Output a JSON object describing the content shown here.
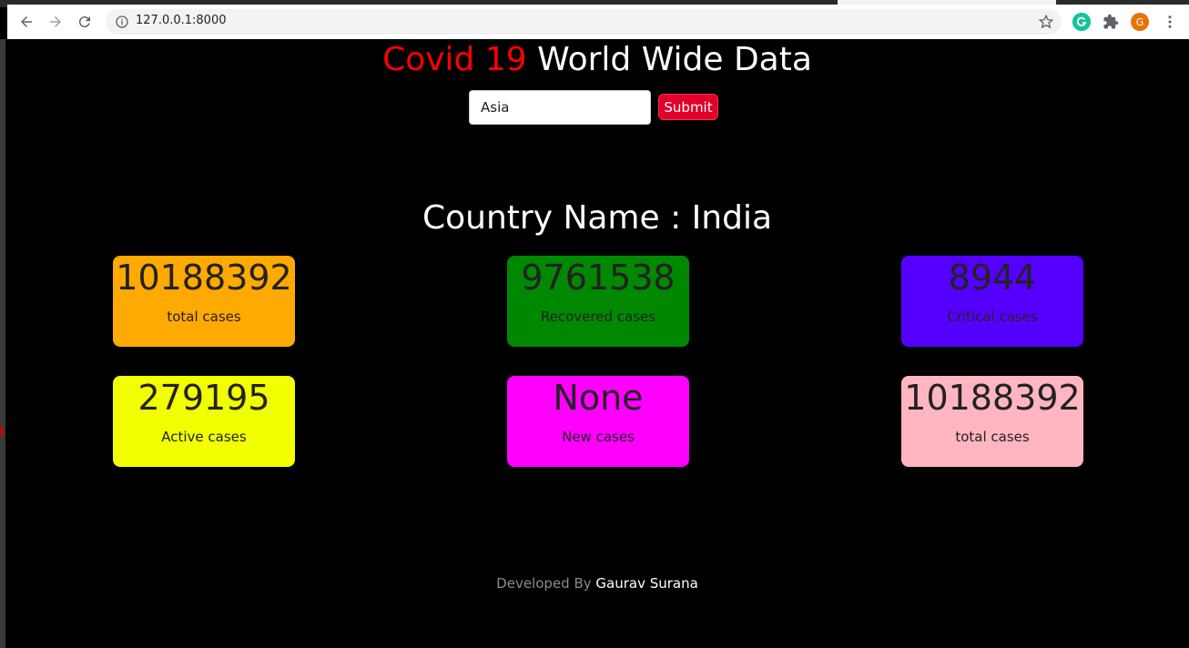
{
  "browser": {
    "url": "127.0.0.1:8000",
    "extensions": [
      {
        "name": "grammarly-icon",
        "color": "#15c39a",
        "letter": ""
      },
      {
        "name": "extensions-puzzle-icon"
      },
      {
        "name": "profile-avatar",
        "color": "#e8710a",
        "letter": "G"
      }
    ]
  },
  "header": {
    "title_highlight": "Covid 19",
    "title_rest": "World Wide Data"
  },
  "search": {
    "value": "Asia",
    "submit_label": "Submit"
  },
  "country": {
    "heading": "Country Name : India"
  },
  "cards": [
    {
      "value": "10188392",
      "label": "total cases",
      "color": "#ffaa00"
    },
    {
      "value": "9761538",
      "label": "Recovered cases",
      "color": "#008800"
    },
    {
      "value": "8944",
      "label": "Critical cases",
      "color": "#5500ff"
    },
    {
      "value": "279195",
      "label": "Active cases",
      "color": "#f2ff00"
    },
    {
      "value": "None",
      "label": "New cases",
      "color": "#ff00ff"
    },
    {
      "value": "10188392",
      "label": "total cases",
      "color": "#ffb6c1"
    }
  ],
  "footer": {
    "prefix": "Developed By",
    "author": "Gaurav Surana"
  }
}
